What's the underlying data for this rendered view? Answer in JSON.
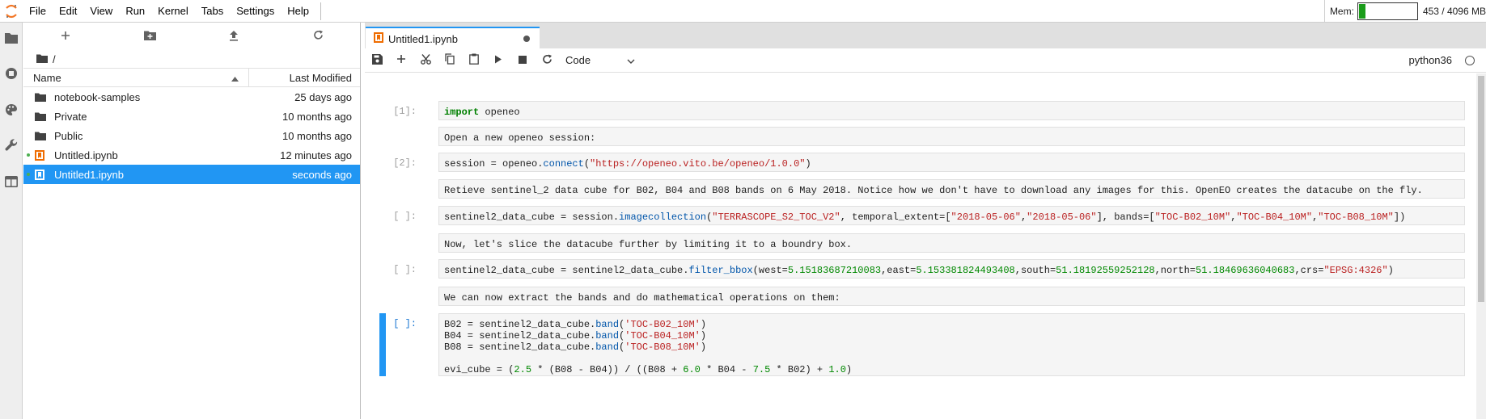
{
  "menubar": {
    "items": [
      "File",
      "Edit",
      "View",
      "Run",
      "Kernel",
      "Tabs",
      "Settings",
      "Help"
    ],
    "memory": {
      "label": "Mem:",
      "text": "453 / 4096 MB",
      "fraction": 0.11,
      "color": "#1a9c1a"
    }
  },
  "activity_icons": [
    "folder-icon",
    "running-icon",
    "palette-icon",
    "wrench-icon",
    "tabs-icon"
  ],
  "filebrowser": {
    "toolbar": [
      "new-launcher-icon",
      "new-folder-icon",
      "upload-icon",
      "refresh-icon"
    ],
    "path": "/",
    "columns": {
      "name": "Name",
      "modified": "Last Modified"
    },
    "files": [
      {
        "name": "notebook-samples",
        "modified": "25 days ago",
        "type": "folder"
      },
      {
        "name": "Private",
        "modified": "10 months ago",
        "type": "folder"
      },
      {
        "name": "Public",
        "modified": "10 months ago",
        "type": "folder"
      },
      {
        "name": "Untitled.ipynb",
        "modified": "12 minutes ago",
        "type": "notebook",
        "running": true
      },
      {
        "name": "Untitled1.ipynb",
        "modified": "seconds ago",
        "type": "notebook",
        "selected": true,
        "running": true
      }
    ]
  },
  "tab": {
    "title": "Untitled1.ipynb"
  },
  "nb_toolbar": {
    "cell_type": "Code",
    "kernel": "python36"
  },
  "cells": [
    {
      "prompt": "[1]:",
      "type": "code",
      "source": "import openeo"
    },
    {
      "prompt": "",
      "type": "markdown",
      "source": "Open a new openeo session:"
    },
    {
      "prompt": "[2]:",
      "type": "code",
      "source": "session = openeo.connect(\"https://openeo.vito.be/openeo/1.0.0\")"
    },
    {
      "prompt": "",
      "type": "markdown",
      "source": "Retieve sentinel_2 data cube for B02, B04 and B08 bands on 6 May 2018. Notice how we don't have to download any images for this. OpenEO creates the datacube on the fly."
    },
    {
      "prompt": "[ ]:",
      "type": "code",
      "source": "sentinel2_data_cube = session.imagecollection(\"TERRASCOPE_S2_TOC_V2\", temporal_extent=[\"2018-05-06\",\"2018-05-06\"], bands=[\"TOC-B02_10M\",\"TOC-B04_10M\",\"TOC-B08_10M\"])"
    },
    {
      "prompt": "",
      "type": "markdown",
      "source": "Now, let's slice the datacube further by limiting it to a boundry box."
    },
    {
      "prompt": "[ ]:",
      "type": "code",
      "source": "sentinel2_data_cube = sentinel2_data_cube.filter_bbox(west=5.15183687210083,east=5.153381824493408,south=51.18192559252128,north=51.18469636040683,crs=\"EPSG:4326\")"
    },
    {
      "prompt": "",
      "type": "markdown",
      "source": "We can now extract the bands and do mathematical operations on them:"
    },
    {
      "prompt": "[ ]:",
      "type": "code",
      "active": true,
      "source": "B02 = sentinel2_data_cube.band('TOC-B02_10M')\nB04 = sentinel2_data_cube.band('TOC-B04_10M')\nB08 = sentinel2_data_cube.band('TOC-B08_10M')\n\nevi_cube = (2.5 * (B08 - B04)) / ((B08 + 6.0 * B04 - 7.5 * B02) + 1.0)"
    }
  ]
}
